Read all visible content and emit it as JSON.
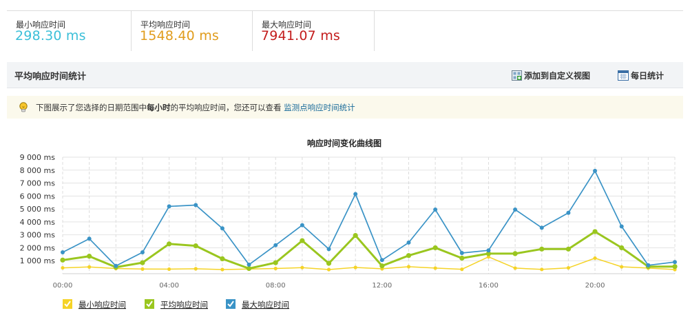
{
  "stats": [
    {
      "label": "最小响应时间",
      "value": "298.30 ms",
      "color": "#3bbfd8"
    },
    {
      "label": "平均响应时间",
      "value": "1548.40 ms",
      "color": "#e09c1c"
    },
    {
      "label": "最大响应时间",
      "value": "7941.07 ms",
      "color": "#c31c1c"
    }
  ],
  "section": {
    "title": "平均响应时间统计",
    "add_view_label": "添加到自定义视图",
    "daily_label": "每日统计"
  },
  "notice": {
    "prefix": "下图展示了您选择的日期范围中",
    "bold": "每小时",
    "middle": "的平均响应时间，您还可以查看",
    "link": "监测点响应时间统计"
  },
  "chart_data": {
    "type": "line",
    "title": "响应时间变化曲线图",
    "x_tick_labels": [
      "00:00",
      "04:00",
      "08:00",
      "12:00",
      "16:00",
      "20:00"
    ],
    "y_tick_labels": [
      "1 000 ms",
      "2 000 ms",
      "3 000 ms",
      "4 000 ms",
      "5 000 ms",
      "6 000 ms",
      "7 000 ms",
      "8 000 ms",
      "9 000 ms"
    ],
    "ylim": [
      0,
      9000
    ],
    "x": [
      0,
      1,
      2,
      3,
      4,
      5,
      6,
      7,
      8,
      9,
      10,
      11,
      12,
      13,
      14,
      15,
      16,
      17,
      18,
      19,
      20,
      21,
      22,
      23
    ],
    "series": [
      {
        "name": "最小响应时间",
        "color": "#f5d327",
        "values": [
          450,
          520,
          400,
          360,
          350,
          380,
          320,
          360,
          400,
          470,
          320,
          480,
          380,
          540,
          430,
          340,
          1300,
          430,
          330,
          450,
          1200,
          530,
          430,
          320
        ]
      },
      {
        "name": "平均响应时间",
        "color": "#9ac61f",
        "values": [
          1050,
          1350,
          500,
          850,
          2300,
          2150,
          1150,
          400,
          850,
          2550,
          800,
          2950,
          600,
          1400,
          2000,
          1200,
          1550,
          1550,
          1900,
          1900,
          3250,
          2000,
          550,
          550
        ]
      },
      {
        "name": "最大响应时间",
        "color": "#3a93c6",
        "values": [
          1650,
          2700,
          600,
          1650,
          5200,
          5300,
          3500,
          700,
          2200,
          3750,
          1900,
          6150,
          1050,
          2400,
          4950,
          1600,
          1800,
          4950,
          3550,
          4700,
          7941,
          3650,
          650,
          900
        ]
      }
    ],
    "grid": true,
    "legend_position": "bottom-left"
  }
}
